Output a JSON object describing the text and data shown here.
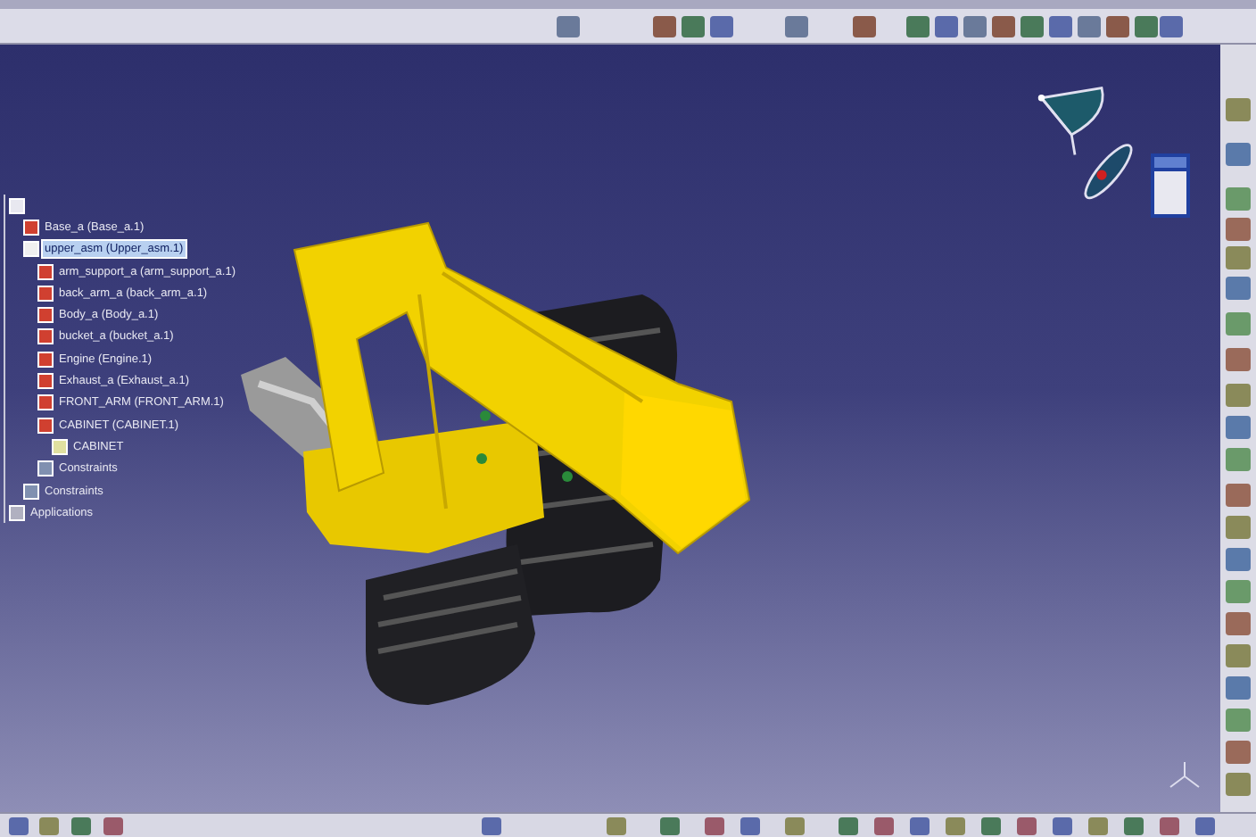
{
  "tree": {
    "nodes": [
      {
        "kind": "root",
        "children": [
          {
            "label": "Base_a (Base_a.1)",
            "kind": "part",
            "selected": false
          },
          {
            "label": "upper_asm (Upper_asm.1)",
            "kind": "product",
            "selected": true,
            "children": [
              {
                "label": "arm_support_a (arm_support_a.1)",
                "kind": "part",
                "selected": false
              },
              {
                "label": "back_arm_a (back_arm_a.1)",
                "kind": "part",
                "selected": false
              },
              {
                "label": "Body_a (Body_a.1)",
                "kind": "part",
                "selected": false
              },
              {
                "label": "bucket_a (bucket_a.1)",
                "kind": "part",
                "selected": false
              },
              {
                "label": "Engine (Engine.1)",
                "kind": "part",
                "selected": false
              },
              {
                "label": "Exhaust_a (Exhaust_a.1)",
                "kind": "part",
                "selected": false
              },
              {
                "label": "FRONT_ARM (FRONT_ARM.1)",
                "kind": "part",
                "selected": false
              },
              {
                "label": "CABINET (CABINET.1)",
                "kind": "part",
                "selected": false,
                "children": [
                  {
                    "label": "CABINET",
                    "kind": "body",
                    "selected": false
                  }
                ]
              },
              {
                "label": "Constraints",
                "kind": "constraints",
                "selected": false
              }
            ]
          },
          {
            "label": "Constraints",
            "kind": "constraints",
            "selected": false
          }
        ]
      },
      {
        "label": "Applications",
        "kind": "applications",
        "selected": false
      }
    ]
  }
}
